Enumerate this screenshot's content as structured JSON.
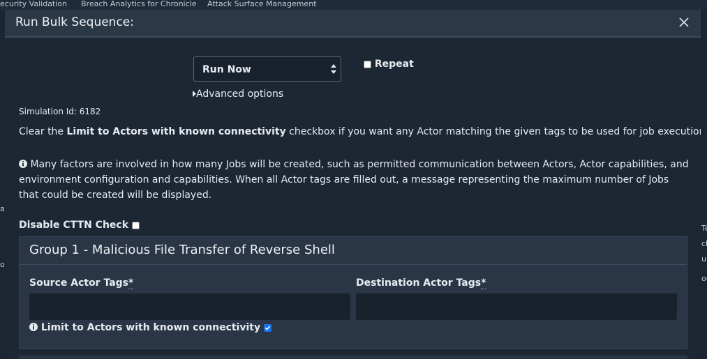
{
  "background": {
    "tabs": [
      "ecurity Validation",
      "Breach Analytics for Chronicle",
      "Attack Surface Management"
    ],
    "left_edge": [
      "ac",
      "o"
    ],
    "right_edge": [
      "Te",
      "ch",
      "u",
      "ou"
    ]
  },
  "modal": {
    "title": "Run Bulk Sequence:",
    "close_icon": "close-icon",
    "run_select": {
      "selected": "Run Now"
    },
    "repeat_label": "Repeat",
    "advanced_options": "Advanced options",
    "simulation_id": "Simulation Id: 6182",
    "clear_text": {
      "prefix": "Clear the ",
      "bold": "Limit to Actors with known connectivity",
      "suffix": " checkbox if you want any Actor matching the given tags to be used for job execution."
    },
    "info_text": "Many factors are involved in how many Jobs will be created, such as permitted communication between Actors, Actor capabilities, and environment configuration and capabilities. When all Actor tags are filled out, a message representing the maximum number of Jobs that could be created will be displayed.",
    "disable_cttn_label": "Disable CTTN Check",
    "group": {
      "title": "Group 1 - Malicious File Transfer of Reverse Shell",
      "source_label": "Source Actor Tags",
      "destination_label": "Destination Actor Tags",
      "required_mark": "*",
      "limit_label": "Limit to Actors with known connectivity",
      "limit_checked": true
    }
  },
  "colors": {
    "accent": "#1a73e8",
    "background": "#1c2633",
    "panel": "#2a3646"
  }
}
